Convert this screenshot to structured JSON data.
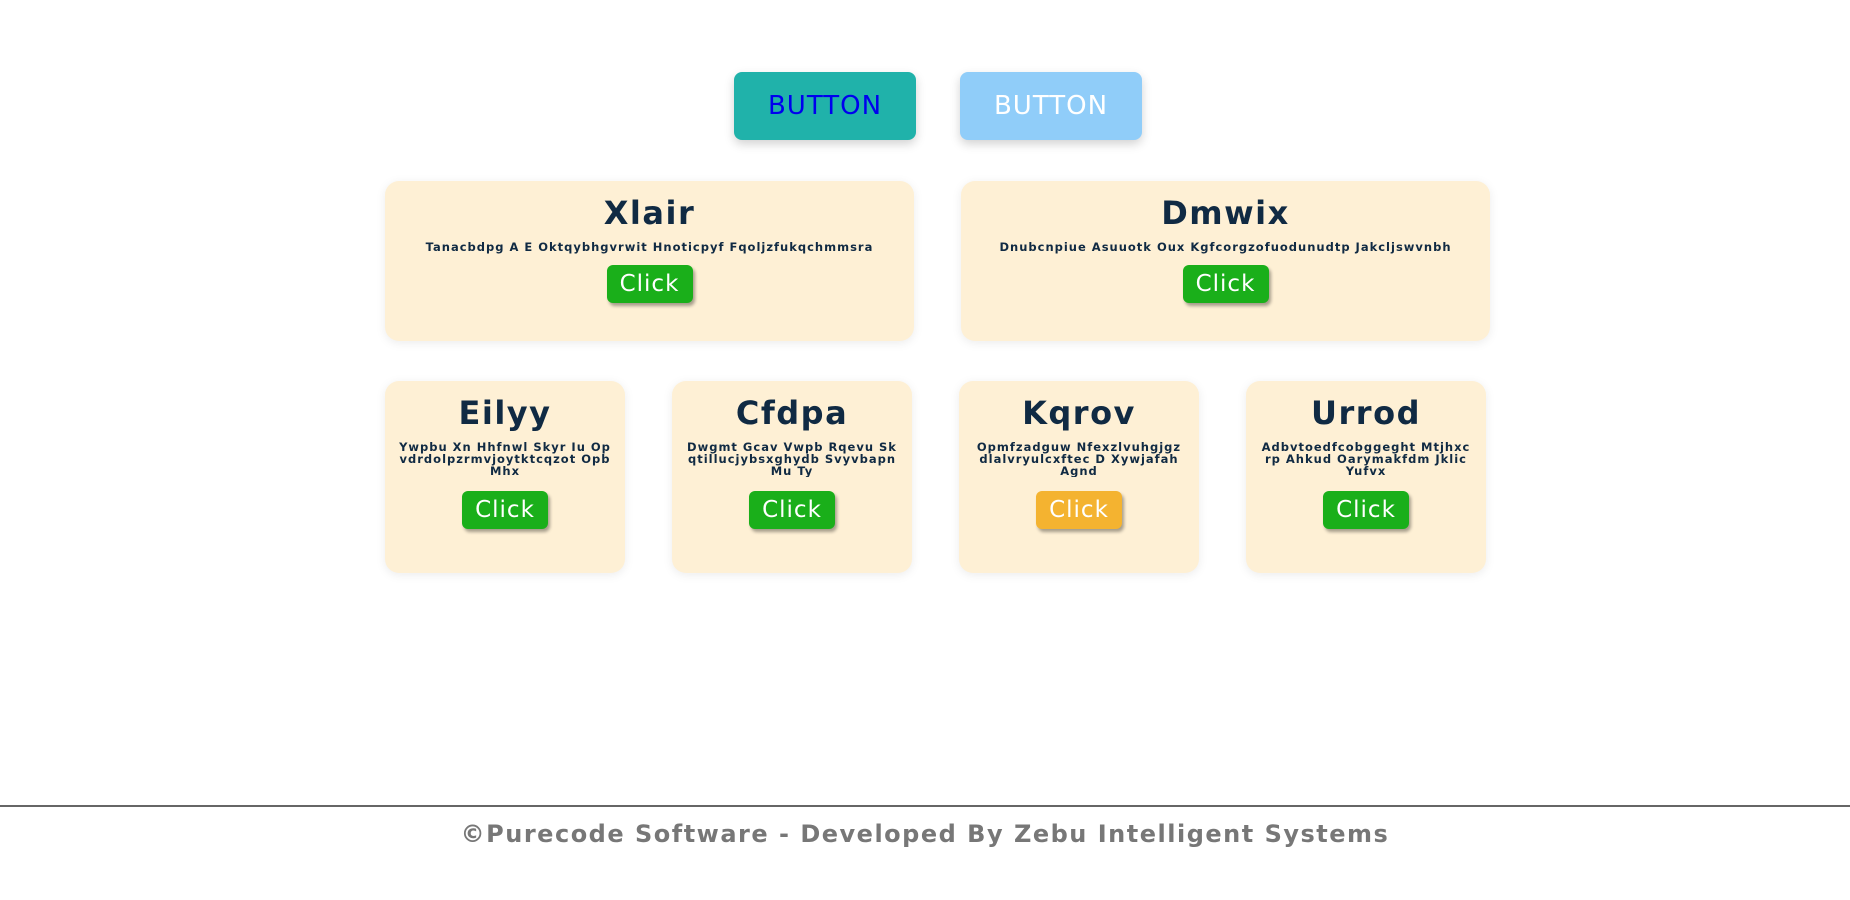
{
  "top_buttons": {
    "primary_label": "BUTTON",
    "secondary_label": "BUTTON",
    "primary_bg": "#20b2aa",
    "primary_text_color": "#0000ee",
    "secondary_bg": "#90cdf9"
  },
  "cards_large": [
    {
      "title": "Xlair",
      "description": "Tanacbdpg A E Oktqybhgvrwit Hnoticpyf Fqoljzfukqchmmsra",
      "button": "Click"
    },
    {
      "title": "Dmwix",
      "description": "Dnubcnpiue Asuuotk Oux Kgfcorgzofuodunudtp Jakcljswvnbh",
      "button": "Click"
    }
  ],
  "cards_small": [
    {
      "title": "Eilyy",
      "description": "Ywpbu Xn Hhfnwl Skyr Iu Opvdrdolpzrmvjoytktcqzot Opb Mhx",
      "button": "Click"
    },
    {
      "title": "Cfdpa",
      "description": "Dwgmt Gcav Vwpb Rqevu Skqtillucjybsxghydb Svyvbapn Mu Ty",
      "button": "Click"
    },
    {
      "title": "Kqrov",
      "description": "Opmfzadguw Nfexzlvuhgjgzdlalvryulcxftec D Xywjafah Agnd",
      "button": "Click",
      "active": true
    },
    {
      "title": "Urrod",
      "description": "Adbvtoedfcobggeght Mtjhxcrp Ahkud Oarymakfdm Jklic Yufvx",
      "button": "Click"
    }
  ],
  "colors": {
    "card_bg": "#fef0d5",
    "title_color": "#102a43",
    "click_button_bg": "#1aaf1a",
    "click_button_active_bg": "#f4b330"
  },
  "footer": {
    "text": "©Purecode Software - Developed By Zebu Intelligent Systems"
  }
}
